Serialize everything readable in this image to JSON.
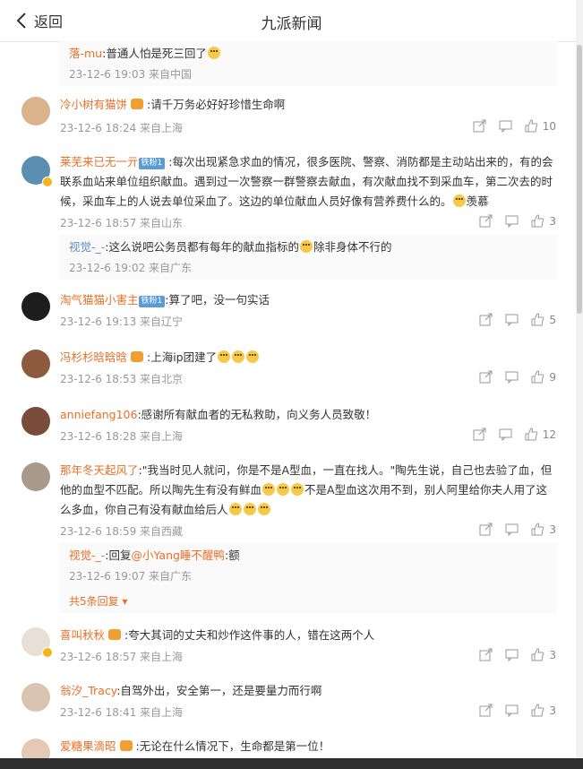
{
  "header": {
    "back_label": "返回",
    "title": "九派新闻"
  },
  "reply_top": {
    "user": "落-mu",
    "text": ":普通人怕是死三回了",
    "meta": "23-12-6 19:03 来自中国"
  },
  "comments": [
    {
      "user": "冷小树有猫饼",
      "text": ":请千万务必好好珍惜生命啊",
      "meta": "23-12-6 18:24 来自上海",
      "likes": "10"
    },
    {
      "user": "莱芜来已无一亓",
      "level": "铁粉1",
      "text": ":每次出现紧急求血的情况，很多医院、警察、消防都是主动站出来的，有的会联系血站来单位组织献血。遇到过一次警察一群警察去献血，有次献血找不到采血车，第二次去的时候，采血车上的人说去单位采血了。这边的单位献血人员好像有营养费什么的。",
      "text_tail": "羡慕",
      "meta": "23-12-6 18:57 来自山东",
      "likes": "3"
    },
    {
      "user": "淘气猫猫小害主",
      "level": "铁粉1",
      "text": ":算了吧，没一句实话",
      "meta": "23-12-6 19:13 来自辽宁",
      "likes": "5"
    },
    {
      "user": "冯杉杉晗晗晗",
      "text": ":上海ip团建了",
      "meta": "23-12-6 18:53 来自北京",
      "likes": "9"
    },
    {
      "user": "anniefang106",
      "text": ":感谢所有献血者的无私救助，向义务人员致敬！",
      "meta": "23-12-6 18:28 来自上海",
      "likes": "12"
    },
    {
      "user": "那年冬天起风了",
      "text": ":\"我当时见人就问，你是不是A型血，一直在找人。\"陶先生说，自己也去验了血，但他的血型不匹配。所以陶先生有没有鲜血",
      "text_mid": "不是A型血这次用不到，别人阿里给你夫人用了这么多血，你自己有没有献血给后人",
      "meta": "23-12-6 18:59 来自西藏",
      "likes": "3"
    },
    {
      "user": "喜叫秋秋",
      "text": ":夸大其词的丈夫和炒作这件事的人，错在这两个人",
      "meta": "23-12-6 18:57 来自上海",
      "likes": "3"
    },
    {
      "user": "翁汐_Tracy",
      "text": ":自驾外出，安全第一，还是要量力而行啊",
      "meta": "23-12-6 18:41 来自上海",
      "likes": "3"
    },
    {
      "user": "爱糖果滴昭",
      "text": ":无论在什么情况下，生命都是第一位！",
      "meta": "",
      "likes": ""
    }
  ],
  "replies": {
    "r1": {
      "user": "视觉-_-",
      "text": ":这么说吧公务员都有每年的献血指标的",
      "text_tail": "除非身体不行的",
      "meta": "23-12-6 19:02 来自广东"
    },
    "r2": {
      "user": "视觉-_-",
      "reply_word": ":回复",
      "mention": "@小Yang睡不醒鸭",
      "text": ":额",
      "meta": "23-12-6 19:07 来自广东",
      "more": "共5条回复"
    }
  },
  "colors": {
    "username": "#e96f25",
    "meta": "#999999",
    "accent": "#5b9bd8"
  }
}
